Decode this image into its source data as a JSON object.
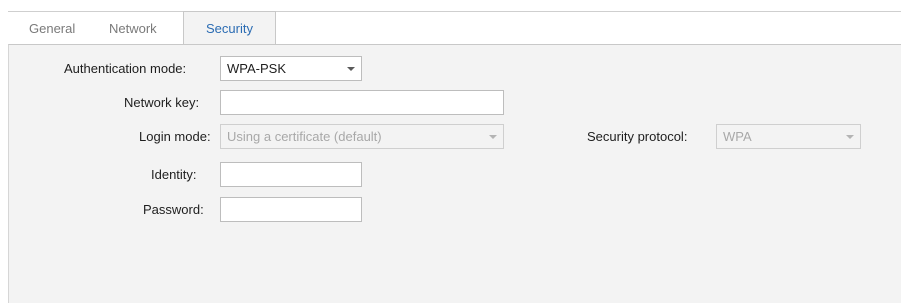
{
  "tabs": [
    {
      "label": "General",
      "active": false
    },
    {
      "label": "Network",
      "active": false
    },
    {
      "label": "Security",
      "active": true
    }
  ],
  "form": {
    "authentication_mode": {
      "label": "Authentication mode:",
      "value": "WPA-PSK",
      "enabled": true
    },
    "network_key": {
      "label": "Network key:",
      "value": "",
      "enabled": true
    },
    "login_mode": {
      "label": "Login mode:",
      "value": "Using a certificate (default)",
      "enabled": false
    },
    "security_protocol": {
      "label": "Security protocol:",
      "value": "WPA",
      "enabled": false
    },
    "identity": {
      "label": "Identity:",
      "value": "",
      "enabled": true
    },
    "password": {
      "label": "Password:",
      "value": "",
      "enabled": true
    }
  },
  "icons": {
    "dropdown": "chevron-down-icon"
  },
  "colors": {
    "active_tab_text": "#2b6cb3",
    "panel_background": "#f3f3f3",
    "disabled_text": "#a8a8a8"
  }
}
